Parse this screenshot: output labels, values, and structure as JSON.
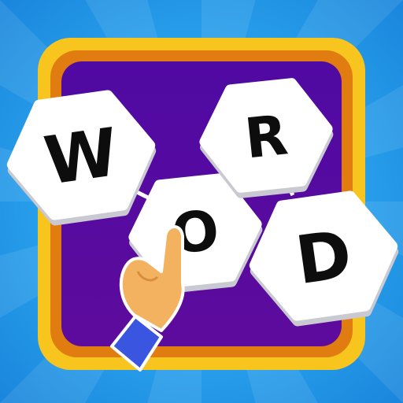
{
  "app_icon": {
    "tiles": [
      {
        "letter": "W"
      },
      {
        "letter": "O"
      },
      {
        "letter": "R"
      },
      {
        "letter": "D"
      }
    ],
    "colors": {
      "background_light": "#2cb2f5",
      "background_dark": "#1583d6",
      "frame_outer": "#f7c51e",
      "frame_inner": "#e07c10",
      "board": "#5b0aa0",
      "tile": "#ffffff",
      "tile_shadow": "#c9c9d2",
      "hand": "#f2b260",
      "sleeve": "#3a55e0"
    },
    "icons": [
      "pointing-hand-icon"
    ]
  }
}
